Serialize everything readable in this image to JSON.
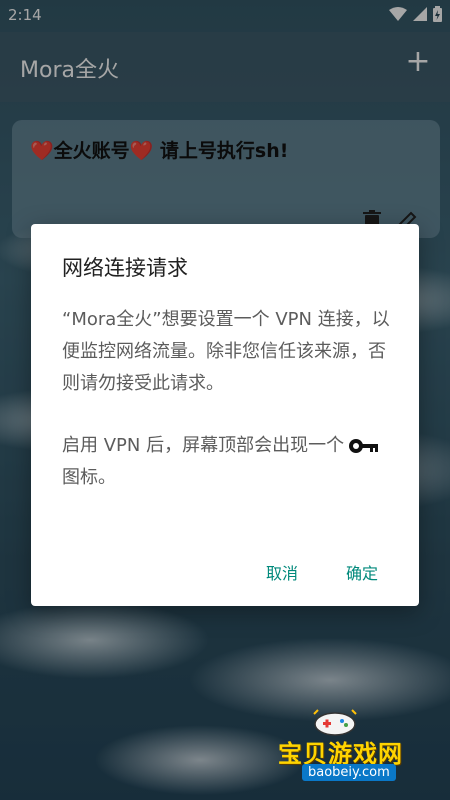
{
  "status_bar": {
    "time": "2:14",
    "icons": [
      "wifi-icon",
      "signal-icon",
      "battery-icon"
    ]
  },
  "appbar": {
    "title": "Mora全火",
    "add_label": "+"
  },
  "card": {
    "title": "❤️全火账号❤️ 请上号执行sh!"
  },
  "dialog": {
    "title": "网络连接请求",
    "message": "“Mora全火”想要设置一个 VPN 连接，以便监控网络流量。除非您信任该来源，否则请勿接受此请求。",
    "notice_before": "启用 VPN 后，屏幕顶部会出现一个",
    "notice_after": "图标。",
    "cancel_label": "取消",
    "ok_label": "确定"
  },
  "watermark": {
    "name": "宝贝游戏网",
    "url": "baobeiy.com"
  },
  "colors": {
    "accent": "#00897b",
    "dialog_bg": "#ffffff"
  }
}
